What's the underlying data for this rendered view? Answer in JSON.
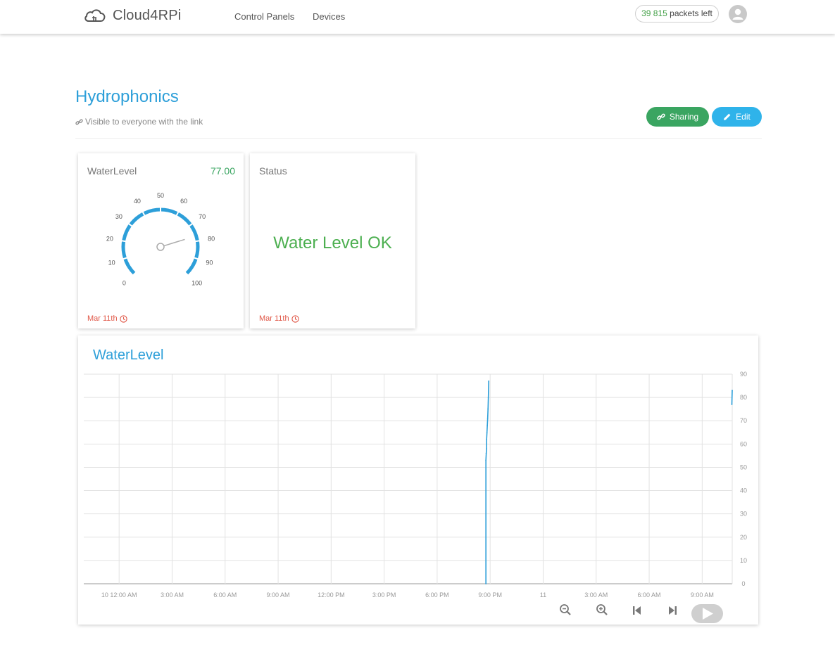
{
  "header": {
    "brand": "Cloud4RPi",
    "nav": [
      {
        "label": "Control Panels"
      },
      {
        "label": "Devices"
      }
    ],
    "packets": {
      "count": "39 815",
      "suffix": "packets left"
    }
  },
  "panel": {
    "title": "Hydrophonics",
    "visibility": "Visible to everyone with the link",
    "buttons": {
      "sharing": "Sharing",
      "edit": "Edit"
    }
  },
  "widgets": {
    "gauge": {
      "title": "WaterLevel",
      "value_text": "77.00",
      "value": 77,
      "min": 0,
      "max": 100,
      "ticks": [
        "0",
        "10",
        "20",
        "30",
        "40",
        "50",
        "60",
        "70",
        "80",
        "90",
        "100"
      ],
      "date": "Mar 11th",
      "accent": "#2d9fd9"
    },
    "status": {
      "title": "Status",
      "text": "Water Level OK",
      "date": "Mar 11th",
      "color": "#4caf50"
    }
  },
  "chart": {
    "title": "WaterLevel"
  },
  "chart_data": {
    "type": "line",
    "title": "WaterLevel",
    "x_tick_labels": [
      "10 12:00 AM",
      "3:00 AM",
      "6:00 AM",
      "9:00 AM",
      "12:00 PM",
      "3:00 PM",
      "6:00 PM",
      "9:00 PM",
      "11",
      "3:00 AM",
      "6:00 AM",
      "9:00 AM"
    ],
    "y_tick_labels": [
      "0",
      "10",
      "20",
      "30",
      "40",
      "50",
      "60",
      "70",
      "80",
      "90"
    ],
    "ylim": [
      0,
      90
    ],
    "xlim_hours": [
      -2,
      34.7
    ],
    "grid": true,
    "series": [
      {
        "color": "#2d9fd9",
        "points": [
          {
            "x": 20.76,
            "y": 0
          },
          {
            "x": 20.76,
            "y": 53
          },
          {
            "x": 20.78,
            "y": 56
          },
          {
            "x": 20.8,
            "y": 58
          },
          {
            "x": 20.8,
            "y": 62
          },
          {
            "x": 20.82,
            "y": 65
          },
          {
            "x": 20.84,
            "y": 68
          },
          {
            "x": 20.86,
            "y": 71
          },
          {
            "x": 20.88,
            "y": 75
          },
          {
            "x": 20.9,
            "y": 80
          },
          {
            "x": 20.92,
            "y": 87
          },
          {
            "x": 34.68,
            "y": 77
          },
          {
            "x": 34.7,
            "y": 83
          }
        ]
      }
    ]
  }
}
